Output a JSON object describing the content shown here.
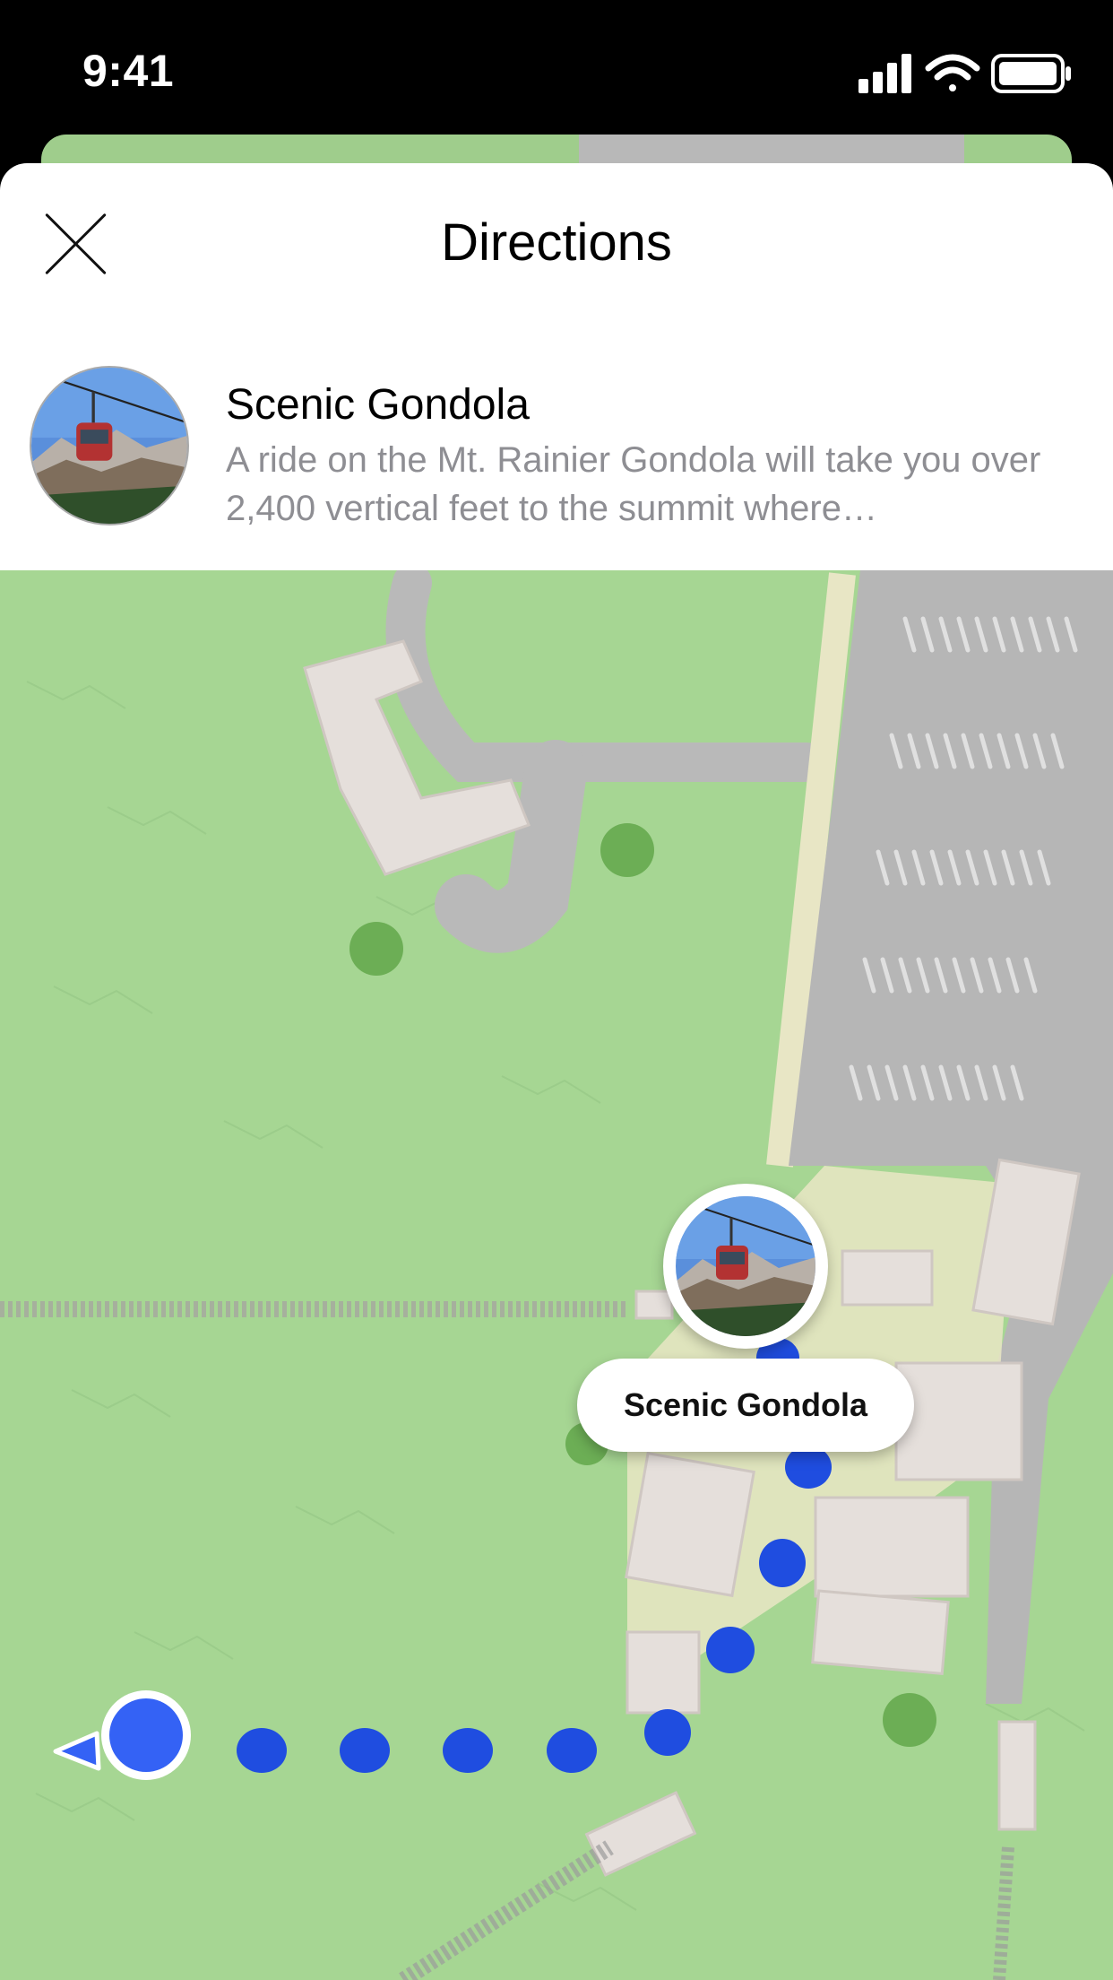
{
  "status_bar": {
    "time": "9:41"
  },
  "sheet": {
    "title": "Directions",
    "place": {
      "name": "Scenic Gondola",
      "description": "A ride on the Mt. Rainier Gondola will take you over 2,400 vertical feet to the summit where…"
    }
  },
  "map": {
    "poi_label": "Scenic Gondola",
    "route_color": "#1f4de0",
    "user_location_color": "#3462f5",
    "grass_color": "#a6d693",
    "road_color": "#b9b9b9"
  },
  "icons": [
    "close-icon",
    "signal-icon",
    "wifi-icon",
    "battery-icon",
    "heading-arrow-icon"
  ]
}
